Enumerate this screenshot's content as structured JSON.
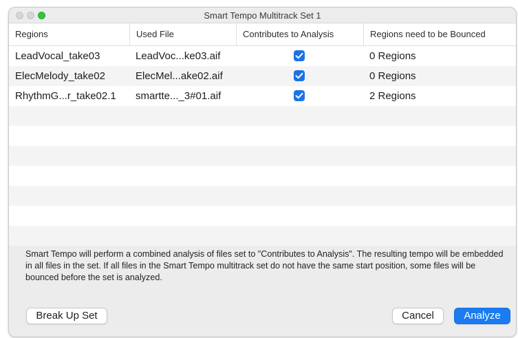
{
  "window": {
    "title": "Smart Tempo Multitrack Set 1"
  },
  "table": {
    "columns": [
      "Regions",
      "Used File",
      "Contributes to Analysis",
      "Regions need to be Bounced"
    ],
    "rows": [
      {
        "region": "LeadVocal_take03",
        "file": "LeadVoc...ke03.aif",
        "contributes": true,
        "bounce": "0 Regions"
      },
      {
        "region": "ElecMelody_take02",
        "file": "ElecMel...ake02.aif",
        "contributes": true,
        "bounce": "0 Regions"
      },
      {
        "region": "RhythmG...r_take02.1",
        "file": "smartte..._3#01.aif",
        "contributes": true,
        "bounce": "2 Regions"
      }
    ]
  },
  "message": "Smart Tempo will perform a combined analysis of files set to \"Contributes to Analysis\". The resulting tempo will be embedded in all files in the set. If all files in the Smart Tempo multitrack set do not have the same start position, some files will be bounced before the set is analyzed.",
  "buttons": {
    "break_up": "Break Up Set",
    "cancel": "Cancel",
    "analyze": "Analyze"
  },
  "colors": {
    "accent": "#1a7cf0",
    "checkbox": "#1a73e8",
    "zoom": "#2fc840"
  },
  "icons": {
    "checkbox": "checkmark-icon"
  }
}
